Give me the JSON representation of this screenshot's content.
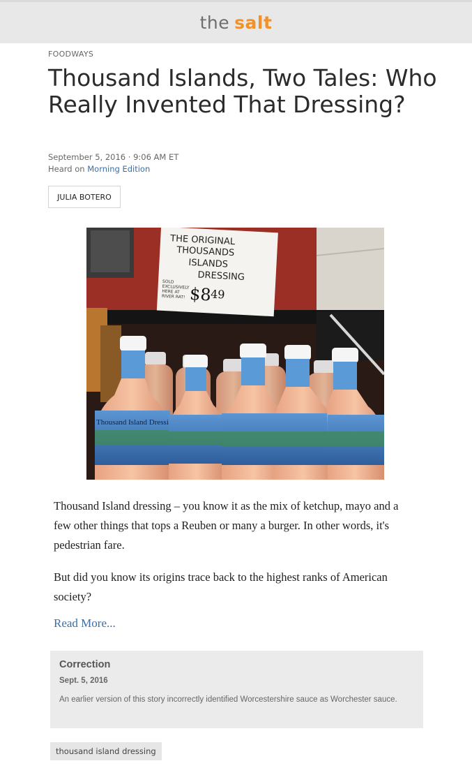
{
  "header": {
    "brand_the": "the",
    "brand_salt": "salt",
    "colors": {
      "background": "#e8e8e8",
      "the": "#6e6e6e",
      "salt": "#f0922b"
    }
  },
  "article": {
    "slug": "FOODWAYS",
    "title": "Thousand Islands, Two Tales: Who Really Invented That Dressing?",
    "dateline": "September 5, 2016 · 9:06 AM ET",
    "heard_prefix": "Heard on",
    "heard_show": "Morning Edition",
    "byline": "JULIA BOTERO",
    "photo": {
      "sign_lines": [
        "THE ORIGINAL",
        "THOUSANDS",
        "ISLANDS",
        "DRESSING"
      ],
      "sign_note": [
        "SOLD",
        "EXCLUSIVELY",
        "HERE AT",
        "RIVER RAT!"
      ],
      "sign_price": "$8",
      "sign_cents": "49",
      "bottle_label": "Thousand Island Dressing"
    },
    "paragraphs": [
      "Thousand Island dressing – you know it as the mix of ketchup, mayo and a few other things that tops a Reuben or many a burger. In other words, it's pedestrian fare.",
      "But did you know its origins trace back to the highest ranks of American society?"
    ],
    "read_more": "Read More...",
    "link_color": "#3a6ea5"
  },
  "correction": {
    "title": "Correction",
    "date": "Sept. 5, 2016",
    "text": "An earlier version of this story incorrectly identified Worcestershire sauce as Worchester sauce."
  },
  "tags": [
    "thousand island dressing"
  ]
}
